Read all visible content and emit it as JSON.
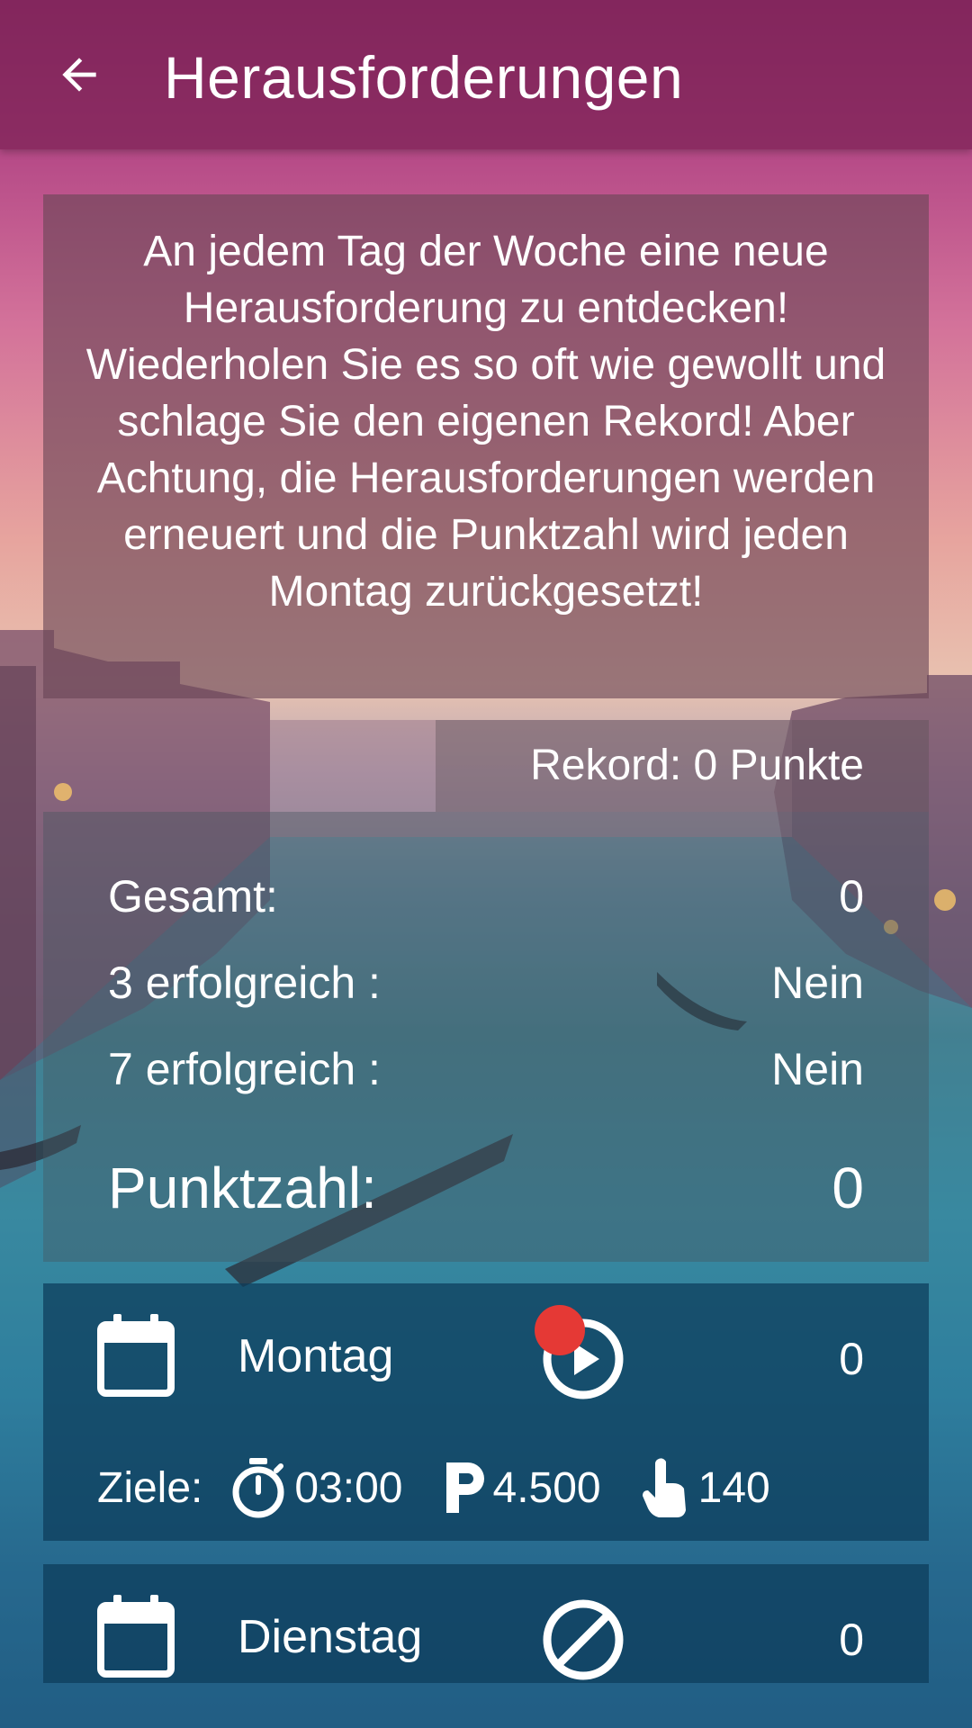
{
  "appbar": {
    "title": "Herausforderungen",
    "back_icon": "arrow-left-icon"
  },
  "intro": {
    "text": "An jedem Tag der Woche eine neue Herausforderung zu entdecken! Wiederholen Sie es so oft wie gewollt und schlage Sie den eigenen Rekord! Aber Achtung, die Herausforderungen werden erneuert und die Punktzahl wird jeden Montag zurückgesetzt!"
  },
  "record": {
    "text": "Rekord: 0 Punkte"
  },
  "stats": {
    "total_label": "Gesamt:",
    "total_value": "0",
    "three_label": "3 erfolgreich :",
    "three_value": "Nein",
    "seven_label": "7 erfolgreich :",
    "seven_value": "Nein",
    "score_label": "Punktzahl:",
    "score_value": "0"
  },
  "days": [
    {
      "label": "Montag",
      "score": "0",
      "status_icon": "play-circle-icon",
      "badge_color": "#e53935",
      "goals": {
        "label": "Ziele:",
        "time": "03:00",
        "points": "4.500",
        "taps": "140"
      }
    },
    {
      "label": "Dienstag",
      "score": "0",
      "status_icon": "blocked-icon"
    }
  ]
}
